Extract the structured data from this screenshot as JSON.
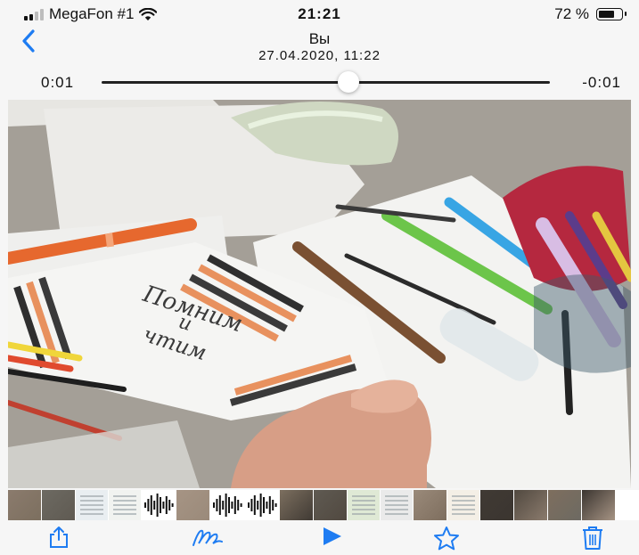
{
  "status_bar": {
    "carrier": "MegaFon #1",
    "time": "21:21",
    "battery_text": "72 %",
    "battery_level": 0.72,
    "signal_bars": 2,
    "signal_max": 4,
    "wifi_icon": "wifi-icon"
  },
  "header": {
    "back_icon": "chevron-left-icon",
    "title": "Вы",
    "subtitle": "27.04.2020, 11:22"
  },
  "scrubber": {
    "elapsed": "0:01",
    "remaining": "-0:01",
    "progress": 0.55
  },
  "video": {
    "handwritten_text": "Помним и чтим"
  },
  "filmstrip": {
    "frames": [
      "photo",
      "photo",
      "document",
      "document",
      "audio",
      "photo",
      "audio",
      "audio",
      "photo",
      "photo",
      "document",
      "document",
      "photo",
      "document",
      "photo",
      "photo",
      "photo",
      "photo"
    ]
  },
  "toolbar": {
    "share_icon": "share-icon",
    "markup_icon": "markup-icon",
    "play_icon": "play-icon",
    "favorite_icon": "star-icon",
    "delete_icon": "trash-icon"
  },
  "colors": {
    "accent": "#1e7cf2",
    "background": "#f6f6f6"
  }
}
